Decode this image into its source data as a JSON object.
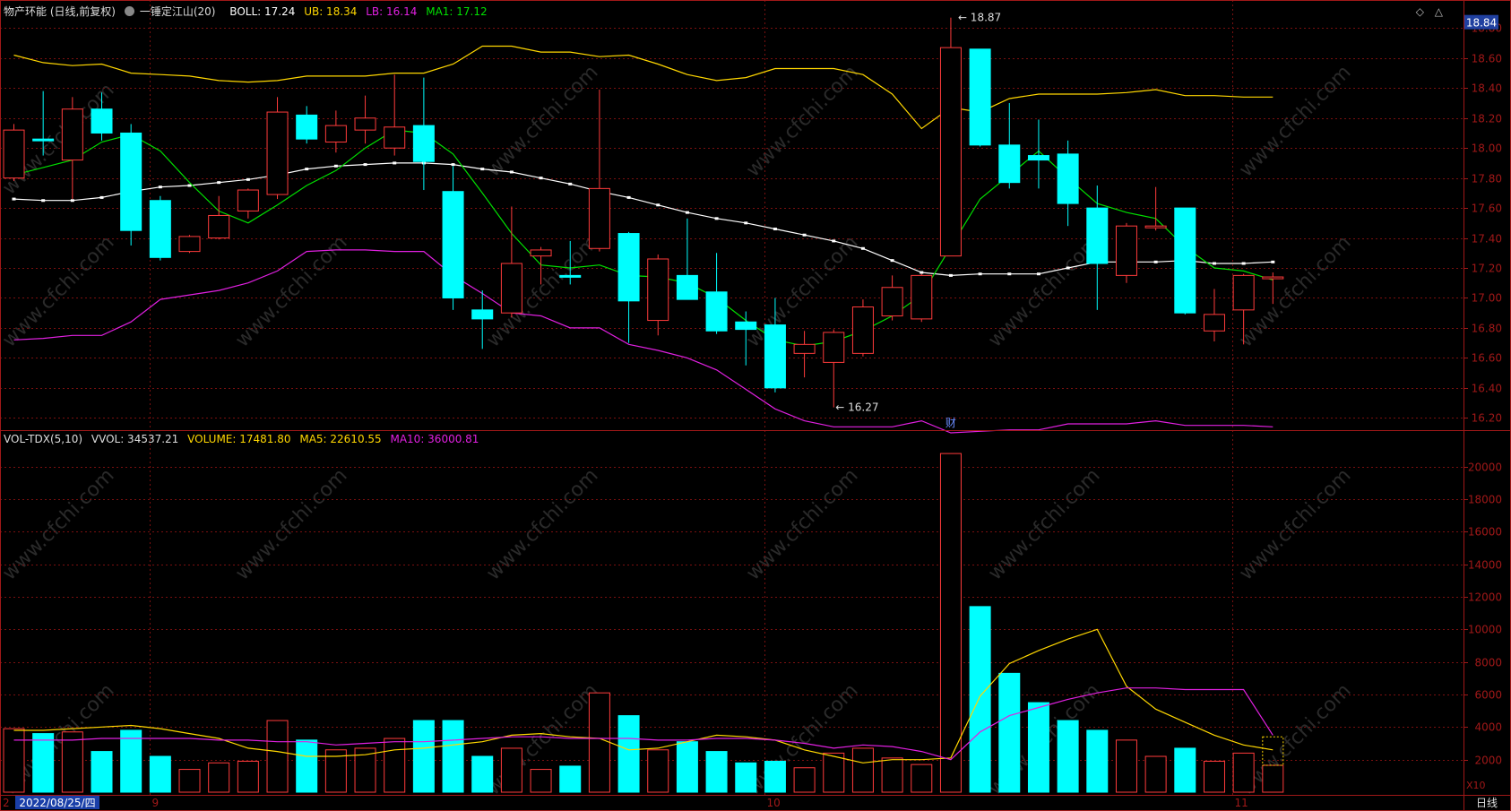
{
  "price_header": {
    "stock": "物产环能 (日线,前复权)",
    "indicator": "一锤定江山(20)",
    "boll": "BOLL: 17.24",
    "ub": "UB: 18.34",
    "lb": "LB: 16.14",
    "ma1": "MA1: 17.12"
  },
  "vol_header": {
    "name": "VOL-TDX(5,10)",
    "vvol": "VVOL: 34537.21",
    "volume": "VOLUME: 17481.80",
    "ma5": "MA5: 22610.55",
    "ma10": "MA10: 36000.81"
  },
  "corner_buttons": {
    "diamond": "◇",
    "triangle": "△"
  },
  "colors": {
    "up": "#ff3b3b",
    "down": "#00ffff",
    "boll_mid": "#ffffff",
    "ub": "#ffd700",
    "lb": "#e020e0",
    "ma1": "#00e000",
    "grid": "#7a1010",
    "axis": "#a01818",
    "vol_ma5": "#ffd700",
    "vol_ma10": "#e020e0"
  },
  "chart_data": [
    {
      "type": "candlestick",
      "price_axis": {
        "ticks": [
          16.2,
          16.4,
          16.6,
          16.8,
          17.0,
          17.2,
          17.4,
          17.6,
          17.8,
          18.0,
          18.2,
          18.4,
          18.6,
          18.8
        ],
        "ylim": [
          16.13,
          18.88
        ]
      },
      "current_price_tag": "18.84",
      "annotations": {
        "high": "18.87",
        "low": "16.27",
        "event": "财"
      },
      "candles": [
        {
          "o": 17.8,
          "h": 18.16,
          "l": 17.78,
          "c": 18.12
        },
        {
          "o": 18.06,
          "h": 18.38,
          "l": 17.95,
          "c": 18.05
        },
        {
          "o": 17.92,
          "h": 18.34,
          "l": 17.66,
          "c": 18.26
        },
        {
          "o": 18.26,
          "h": 18.37,
          "l": 18.05,
          "c": 18.1
        },
        {
          "o": 18.1,
          "h": 18.16,
          "l": 17.35,
          "c": 17.45
        },
        {
          "o": 17.65,
          "h": 17.68,
          "l": 17.25,
          "c": 17.27
        },
        {
          "o": 17.31,
          "h": 17.42,
          "l": 17.3,
          "c": 17.41
        },
        {
          "o": 17.4,
          "h": 17.68,
          "l": 17.39,
          "c": 17.55
        },
        {
          "o": 17.58,
          "h": 17.73,
          "l": 17.53,
          "c": 17.72
        },
        {
          "o": 17.69,
          "h": 18.34,
          "l": 17.66,
          "c": 18.24
        },
        {
          "o": 18.22,
          "h": 18.28,
          "l": 18.03,
          "c": 18.06
        },
        {
          "o": 18.04,
          "h": 18.25,
          "l": 17.97,
          "c": 18.15
        },
        {
          "o": 18.12,
          "h": 18.35,
          "l": 18.03,
          "c": 18.2
        },
        {
          "o": 18.0,
          "h": 18.49,
          "l": 17.95,
          "c": 18.14
        },
        {
          "o": 18.15,
          "h": 18.47,
          "l": 17.72,
          "c": 17.91
        },
        {
          "o": 17.71,
          "h": 17.88,
          "l": 16.92,
          "c": 17.0
        },
        {
          "o": 16.92,
          "h": 17.05,
          "l": 16.66,
          "c": 16.86
        },
        {
          "o": 16.9,
          "h": 17.61,
          "l": 16.87,
          "c": 17.23
        },
        {
          "o": 17.28,
          "h": 17.34,
          "l": 17.09,
          "c": 17.32
        },
        {
          "o": 17.15,
          "h": 17.38,
          "l": 17.09,
          "c": 17.14
        },
        {
          "o": 17.33,
          "h": 18.39,
          "l": 17.31,
          "c": 17.73
        },
        {
          "o": 17.43,
          "h": 17.44,
          "l": 16.7,
          "c": 16.98
        },
        {
          "o": 16.85,
          "h": 17.29,
          "l": 16.75,
          "c": 17.26
        },
        {
          "o": 17.15,
          "h": 17.53,
          "l": 17.0,
          "c": 16.99
        },
        {
          "o": 17.04,
          "h": 17.3,
          "l": 16.76,
          "c": 16.78
        },
        {
          "o": 16.84,
          "h": 16.91,
          "l": 16.55,
          "c": 16.79
        },
        {
          "o": 16.82,
          "h": 17.0,
          "l": 16.37,
          "c": 16.4
        },
        {
          "o": 16.63,
          "h": 16.78,
          "l": 16.47,
          "c": 16.69
        },
        {
          "o": 16.57,
          "h": 16.79,
          "l": 16.27,
          "c": 16.77
        },
        {
          "o": 16.63,
          "h": 16.99,
          "l": 16.61,
          "c": 16.94
        },
        {
          "o": 16.88,
          "h": 17.15,
          "l": 16.85,
          "c": 17.07
        },
        {
          "o": 16.86,
          "h": 17.16,
          "l": 16.84,
          "c": 17.15
        },
        {
          "o": 17.28,
          "h": 18.87,
          "l": 17.28,
          "c": 18.67
        },
        {
          "o": 18.66,
          "h": 18.66,
          "l": 18.01,
          "c": 18.02
        },
        {
          "o": 18.02,
          "h": 18.3,
          "l": 17.73,
          "c": 17.77
        },
        {
          "o": 17.95,
          "h": 18.19,
          "l": 17.73,
          "c": 17.92
        },
        {
          "o": 17.96,
          "h": 18.05,
          "l": 17.48,
          "c": 17.63
        },
        {
          "o": 17.6,
          "h": 17.75,
          "l": 16.92,
          "c": 17.23
        },
        {
          "o": 17.15,
          "h": 17.5,
          "l": 17.1,
          "c": 17.48
        },
        {
          "o": 17.47,
          "h": 17.74,
          "l": 17.45,
          "c": 17.48
        },
        {
          "o": 17.6,
          "h": 17.6,
          "l": 16.89,
          "c": 16.9
        },
        {
          "o": 16.78,
          "h": 17.06,
          "l": 16.71,
          "c": 16.89
        },
        {
          "o": 16.92,
          "h": 17.16,
          "l": 16.69,
          "c": 17.15
        },
        {
          "o": 17.14,
          "h": 17.17,
          "l": 16.96,
          "c": 17.14
        }
      ],
      "boll_mid": [
        17.66,
        17.65,
        17.65,
        17.67,
        17.71,
        17.74,
        17.75,
        17.77,
        17.79,
        17.82,
        17.86,
        17.88,
        17.89,
        17.9,
        17.9,
        17.89,
        17.86,
        17.84,
        17.8,
        17.76,
        17.71,
        17.67,
        17.62,
        17.57,
        17.53,
        17.5,
        17.46,
        17.42,
        17.38,
        17.33,
        17.25,
        17.17,
        17.15,
        17.16,
        17.16,
        17.16,
        17.2,
        17.24,
        17.24,
        17.24,
        17.25,
        17.23,
        17.23,
        17.24
      ],
      "ub": [
        18.62,
        18.57,
        18.55,
        18.56,
        18.5,
        18.49,
        18.48,
        18.45,
        18.44,
        18.45,
        18.48,
        18.48,
        18.48,
        18.5,
        18.5,
        18.56,
        18.68,
        18.68,
        18.64,
        18.64,
        18.61,
        18.62,
        18.56,
        18.49,
        18.45,
        18.47,
        18.53,
        18.53,
        18.53,
        18.49,
        18.36,
        18.13,
        18.27,
        18.24,
        18.33,
        18.36,
        18.36,
        18.36,
        18.37,
        18.39,
        18.35,
        18.35,
        18.34,
        18.34
      ],
      "lb": [
        16.72,
        16.73,
        16.75,
        16.75,
        16.84,
        16.99,
        17.02,
        17.05,
        17.1,
        17.18,
        17.31,
        17.32,
        17.32,
        17.31,
        17.31,
        17.15,
        17.03,
        16.9,
        16.88,
        16.8,
        16.8,
        16.69,
        16.65,
        16.6,
        16.52,
        16.39,
        16.26,
        16.18,
        16.14,
        16.14,
        16.14,
        16.18,
        16.1,
        16.11,
        16.12,
        16.12,
        16.16,
        16.16,
        16.16,
        16.18,
        16.15,
        16.15,
        16.15,
        16.14
      ],
      "ma1": [
        17.82,
        17.87,
        17.92,
        18.04,
        18.09,
        17.98,
        17.77,
        17.58,
        17.5,
        17.62,
        17.75,
        17.85,
        18.0,
        18.12,
        18.1,
        17.96,
        17.7,
        17.43,
        17.22,
        17.2,
        17.22,
        17.15,
        17.14,
        17.1,
        17.0,
        16.85,
        16.72,
        16.68,
        16.71,
        16.78,
        16.88,
        17.02,
        17.34,
        17.66,
        17.82,
        17.98,
        17.8,
        17.63,
        17.57,
        17.53,
        17.34,
        17.2,
        17.18,
        17.12
      ]
    },
    {
      "type": "bar",
      "volume_axis": {
        "ticks": [
          2000,
          4000,
          6000,
          8000,
          10000,
          12000,
          14000,
          16000,
          18000,
          20000
        ],
        "ylim": [
          0,
          21300
        ],
        "unit": "X10"
      },
      "volumes": [
        3900,
        3600,
        3700,
        2500,
        3800,
        2200,
        1400,
        1800,
        1900,
        4400,
        3200,
        2600,
        2700,
        3300,
        4400,
        4400,
        2200,
        2700,
        1400,
        1600,
        6100,
        4700,
        2600,
        3100,
        2500,
        1800,
        1900,
        1500,
        2400,
        2700,
        2100,
        1700,
        20800,
        11400,
        7300,
        5500,
        4400,
        3800,
        3200,
        2200,
        2700,
        1900,
        2400,
        1650
      ],
      "ma5": [
        3800,
        3800,
        3900,
        4000,
        4100,
        3900,
        3600,
        3300,
        2700,
        2500,
        2200,
        2200,
        2300,
        2600,
        2700,
        2900,
        3100,
        3500,
        3600,
        3400,
        3300,
        2600,
        2700,
        3100,
        3500,
        3400,
        3200,
        2600,
        2200,
        1800,
        2000,
        2000,
        2100,
        5900,
        7900,
        8700,
        9400,
        10000,
        6500,
        5100,
        4300,
        3500,
        2900,
        2600
      ],
      "ma10": [
        3200,
        3200,
        3200,
        3300,
        3300,
        3300,
        3300,
        3200,
        3200,
        3100,
        3100,
        2900,
        3000,
        3100,
        3100,
        3200,
        3300,
        3400,
        3400,
        3300,
        3300,
        3300,
        3200,
        3200,
        3300,
        3300,
        3200,
        3000,
        2700,
        2900,
        2800,
        2500,
        2000,
        3700,
        4700,
        5200,
        5700,
        6100,
        6400,
        6400,
        6300,
        6300,
        6300,
        3500
      ]
    }
  ],
  "date_axis": {
    "first": "2022/08/25/四",
    "edge_text": "2",
    "months": [
      "9",
      "10",
      "11"
    ]
  },
  "period_label": "日线",
  "watermark": "www.cfchi.com"
}
